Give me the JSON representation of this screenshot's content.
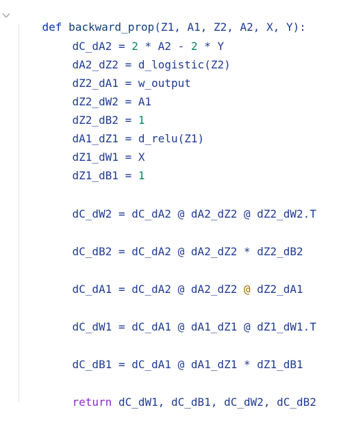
{
  "code": {
    "line1": {
      "def": "def",
      "fn_name": "backward_prop",
      "params": "(Z1, A1, Z2, A2, X, Y):"
    },
    "line2": {
      "lhs": "dC_dA2",
      "eq": " = ",
      "n1": "2",
      "op1": " * A2 - ",
      "n2": "2",
      "rest": " * Y"
    },
    "line3": {
      "text": "dA2_dZ2 = d_logistic(Z2)"
    },
    "line4": {
      "text": "dZ2_dA1 = w_output"
    },
    "line5": {
      "text": "dZ2_dW2 = A1"
    },
    "line6": {
      "lhs": "dZ2_dB2 = ",
      "num": "1"
    },
    "line7": {
      "text": "dA1_dZ1 = d_relu(Z1)"
    },
    "line8": {
      "text": "dZ1_dW1 = X"
    },
    "line9": {
      "lhs": "dZ1_dB1 = ",
      "num": "1"
    },
    "line10": {
      "text": "dC_dW2 = dC_dA2 @ dA2_dZ2 @ dZ2_dW2.T"
    },
    "line11": {
      "text": "dC_dB2 = dC_dA2 @ dA2_dZ2 * dZ2_dB2"
    },
    "line12": {
      "p1": "dC_dA1 = dC_dA2 @ dA2_dZ2 ",
      "at": "@",
      "p2": " dZ2_dA1"
    },
    "line13": {
      "text": "dC_dW1 = dC_dA1 @ dA1_dZ1 @ dZ1_dW1.T"
    },
    "line14": {
      "text": "dC_dB1 = dC_dA1 @ dA1_dZ1 * dZ1_dB1"
    },
    "line15": {
      "ret": "return",
      "rest": " dC_dW1, dC_dB1, dC_dW2, dC_dB2"
    }
  },
  "colors": {
    "keyword_def": "#0033b3",
    "keyword_return": "#8a2bc7",
    "identifier": "#1f3a93",
    "number": "#098658",
    "highlight_at": "#a06b00"
  },
  "icons": {
    "fold": "chevron-down-icon"
  }
}
